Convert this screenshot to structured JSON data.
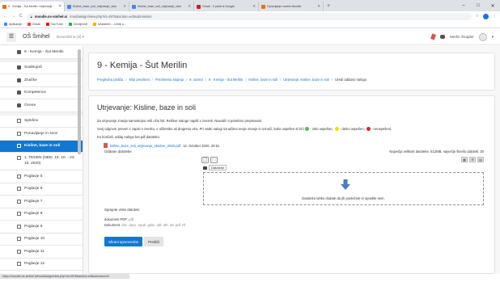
{
  "browser": {
    "tabs": [
      {
        "title": "9 - Kemija - Šut Merilin: Utrjevanje",
        "active": true
      },
      {
        "title": "Kisline_baze_soli_utrjevanje_okto",
        "active": false
      },
      {
        "title": "Kisline_baze_soli_utrjevanje_okto",
        "active": false
      },
      {
        "title": "Gmail - V pošti ni Google",
        "active": false
      },
      {
        "title": "Opravljanje vsebin Moodle",
        "active": false
      }
    ],
    "new_tab": "+",
    "window_controls": [
      "–",
      "□",
      "✕"
    ],
    "address": {
      "host": "moodle.os-smihel.si",
      "path": "/mod/assign/view.php?id=4978&action=editsubmission"
    },
    "bookmarks": [
      "Aplikacije",
      "Gmail",
      "YouTube",
      "Zemljevidi",
      "eAsistent – Urnik u..."
    ]
  },
  "navbar": {
    "menu_icon": "☰",
    "site_name": "OŠ Šmihel",
    "language": "Slovenščina (sl) ▾",
    "user_name": "Merlin Šnajder"
  },
  "sidebar": {
    "items": [
      {
        "label": "9 - Kemija - Šut Merilin",
        "icon": "solid",
        "active": false
      },
      {
        "label": "Sodelujoči",
        "icon": "solid",
        "active": false
      },
      {
        "label": "Značke",
        "icon": "solid",
        "active": false
      },
      {
        "label": "Kompetence",
        "icon": "solid",
        "active": false
      },
      {
        "label": "Ocene",
        "icon": "solid",
        "active": false
      },
      {
        "label": "Splošno",
        "icon": "folder",
        "active": false
      },
      {
        "label": "Ponavljanje in snov",
        "icon": "folder",
        "active": false
      },
      {
        "label": "Kisline, baze in soli",
        "icon": "folder",
        "active": true
      },
      {
        "label": "1. TEDEN (NEĐ: 19. 10. - 23. 10. 2020)",
        "icon": "folder",
        "active": false
      },
      {
        "label": "Poglavje 5",
        "icon": "folder",
        "active": false
      },
      {
        "label": "Poglavje 6",
        "icon": "folder",
        "active": false
      },
      {
        "label": "Poglavje 7",
        "icon": "folder",
        "active": false
      },
      {
        "label": "Poglavje 8",
        "icon": "folder",
        "active": false
      },
      {
        "label": "Poglavje 9",
        "icon": "folder",
        "active": false
      },
      {
        "label": "Poglavje 10",
        "icon": "folder",
        "active": false
      },
      {
        "label": "Poglavje 11",
        "icon": "folder",
        "active": false
      },
      {
        "label": "Poglavje 12",
        "icon": "folder",
        "active": false
      },
      {
        "label": "Poglavje 13",
        "icon": "folder",
        "active": false
      }
    ]
  },
  "header": {
    "course_title": "9 - Kemija - Šut Merilin",
    "breadcrumb": [
      "Pregledna plošča",
      "Moji predmeti",
      "Predmetna stopnja",
      "9. razred",
      "9 - Kemija - Šut Merilin",
      "Kisline, baze in soli",
      "Utrjevanje: Kisline, baze in soli",
      "Uredi oddano nalogo"
    ]
  },
  "assignment": {
    "title": "Utrjevanje: Kisline, baze in soli",
    "line1": "Za utrjevanje znanja samostojno reši učni list. Rešitve naloge napiši v zvezek. Navodil ni potrebno prepisovati.",
    "line2_start": "Svoj odgovor preveri z zapisi v zvezku, v učbeniku ali drugemu viru. Pri vsaki nalogi označimo svoje znanje in označi, kako uspešen si bil",
    "legend": [
      {
        "color": "#5cb85c",
        "text": "- zelo uspešen,"
      },
      {
        "color": "#f0e000",
        "text": "- delno uspešen,"
      },
      {
        "color": "#d9232d",
        "text": "- neuspešen)."
      }
    ],
    "line3": "Ko končaš, oddaj nalogo kot pdf datoteko.",
    "attachment_name": "kisline_baze_soli_utrjevanje_oktober_2020.pdf",
    "attachment_date": "12. October 2020, 20:51"
  },
  "submission": {
    "label": "Oddane datoteke",
    "limits": "Največja velikost datoteke: 512MB, največje število datotek: 20",
    "toolbar": [
      "🗋",
      "🗀"
    ],
    "views": [
      "▦",
      "☰",
      "▤"
    ],
    "path_tip": "Datoteke",
    "drop_text": "Datoteko lahko dodate da jih povlečete in spustite sem.",
    "types_title": "Sprejete vrste datotek:",
    "types": [
      {
        "name": "dokument PDF",
        "ext": ".pdf"
      },
      {
        "name": "Dokument",
        "ext": ".doc .docx .epub .gdoc .odt .oth .ott .pdf .rtf"
      }
    ],
    "save_label": "Shrani spremembe",
    "cancel_label": "Prekliči"
  },
  "status_url": "https://moodle.os-smihel.si/mod/assign/view.php?id=4978&action=editsubmission#"
}
